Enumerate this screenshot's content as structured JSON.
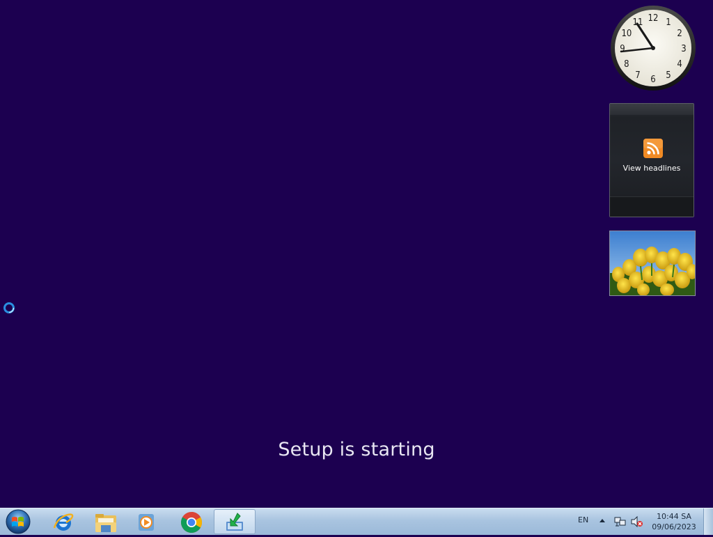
{
  "desktop": {
    "setup_message": "Setup is starting"
  },
  "gadgets": {
    "clock": {
      "numerals": [
        "12",
        "1",
        "2",
        "3",
        "4",
        "5",
        "6",
        "7",
        "8",
        "9",
        "10",
        "11"
      ],
      "time_shown": "10:44"
    },
    "feed_headlines": {
      "label": "View headlines",
      "icon": "rss-icon"
    },
    "slideshow": {
      "subject": "yellow tulips"
    }
  },
  "taskbar": {
    "start_icon": "windows-logo-icon",
    "pinned": [
      {
        "name": "Internet Explorer",
        "icon": "internet-explorer-icon"
      },
      {
        "name": "Windows Explorer",
        "icon": "folder-icon"
      },
      {
        "name": "Windows Media Player",
        "icon": "media-player-icon"
      },
      {
        "name": "Google Chrome",
        "icon": "chrome-icon"
      },
      {
        "name": "Setup",
        "icon": "setup-icon",
        "active": true
      }
    ],
    "tray": {
      "language": "EN",
      "time": "10:44 SA",
      "date": "09/06/2023",
      "icons": [
        "show-hidden-icons-arrow",
        "network-icon",
        "volume-muted-icon"
      ]
    }
  },
  "colors": {
    "desktop_background": "#1c0050",
    "taskbar": "#a9c4e0"
  }
}
